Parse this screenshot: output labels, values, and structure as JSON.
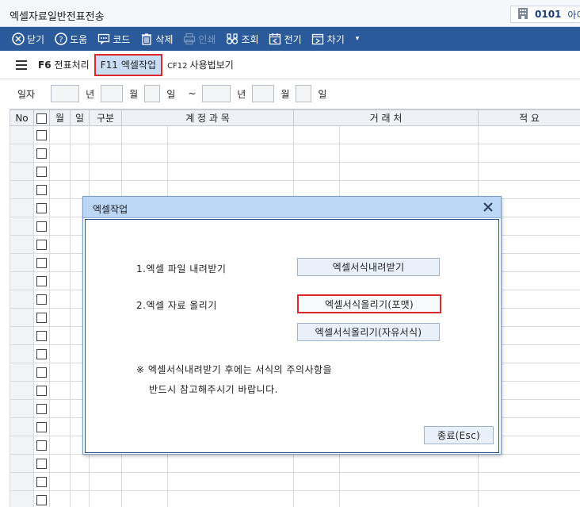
{
  "window": {
    "title": "엑셀자료일반전표전송",
    "company_code": "0101",
    "company_name": "아이"
  },
  "toolbar": {
    "items": [
      {
        "label": "닫기",
        "icon": "close-circle-icon",
        "enabled": true
      },
      {
        "label": "도움",
        "icon": "help-circle-icon",
        "enabled": true
      },
      {
        "label": "코드",
        "icon": "code-icon",
        "enabled": true
      },
      {
        "label": "삭제",
        "icon": "trash-icon",
        "enabled": true
      },
      {
        "label": "인쇄",
        "icon": "printer-icon",
        "enabled": false
      },
      {
        "label": "조회",
        "icon": "binoculars-icon",
        "enabled": true
      },
      {
        "label": "전기",
        "icon": "calendar-icon",
        "enabled": true
      },
      {
        "label": "차기",
        "icon": "next-icon",
        "enabled": true
      }
    ],
    "more_icon": "chevron-down-icon"
  },
  "functions": [
    {
      "key": "F6",
      "label": "전표처리"
    },
    {
      "key": "F11",
      "label": "엑셀작업"
    },
    {
      "key": "CF12",
      "label": "사용법보기"
    }
  ],
  "date_filter": {
    "label": "일자",
    "year": "년",
    "month": "월",
    "day": "일",
    "tilde": "~"
  },
  "grid": {
    "headers": [
      "No",
      "",
      "월",
      "일",
      "구분",
      "계 정 과 목",
      "",
      "거 래 처",
      "",
      "적 요"
    ]
  },
  "dialog": {
    "title": "엑셀작업",
    "step1": "1.엑셀 파일 내려받기",
    "step2": "2.엑셀 자료 올리기",
    "btn_download": "엑셀서식내려받기",
    "btn_upload_format": "엑셀서식올리기(포맷)",
    "btn_upload_free": "엑셀서식올리기(자유서식)",
    "note_line1": "※ 엑셀서식내려받기 후에는 서식의 주의사항을",
    "note_line2": "반드시 참고해주시기 바랍니다.",
    "btn_close": "종료(Esc)"
  }
}
